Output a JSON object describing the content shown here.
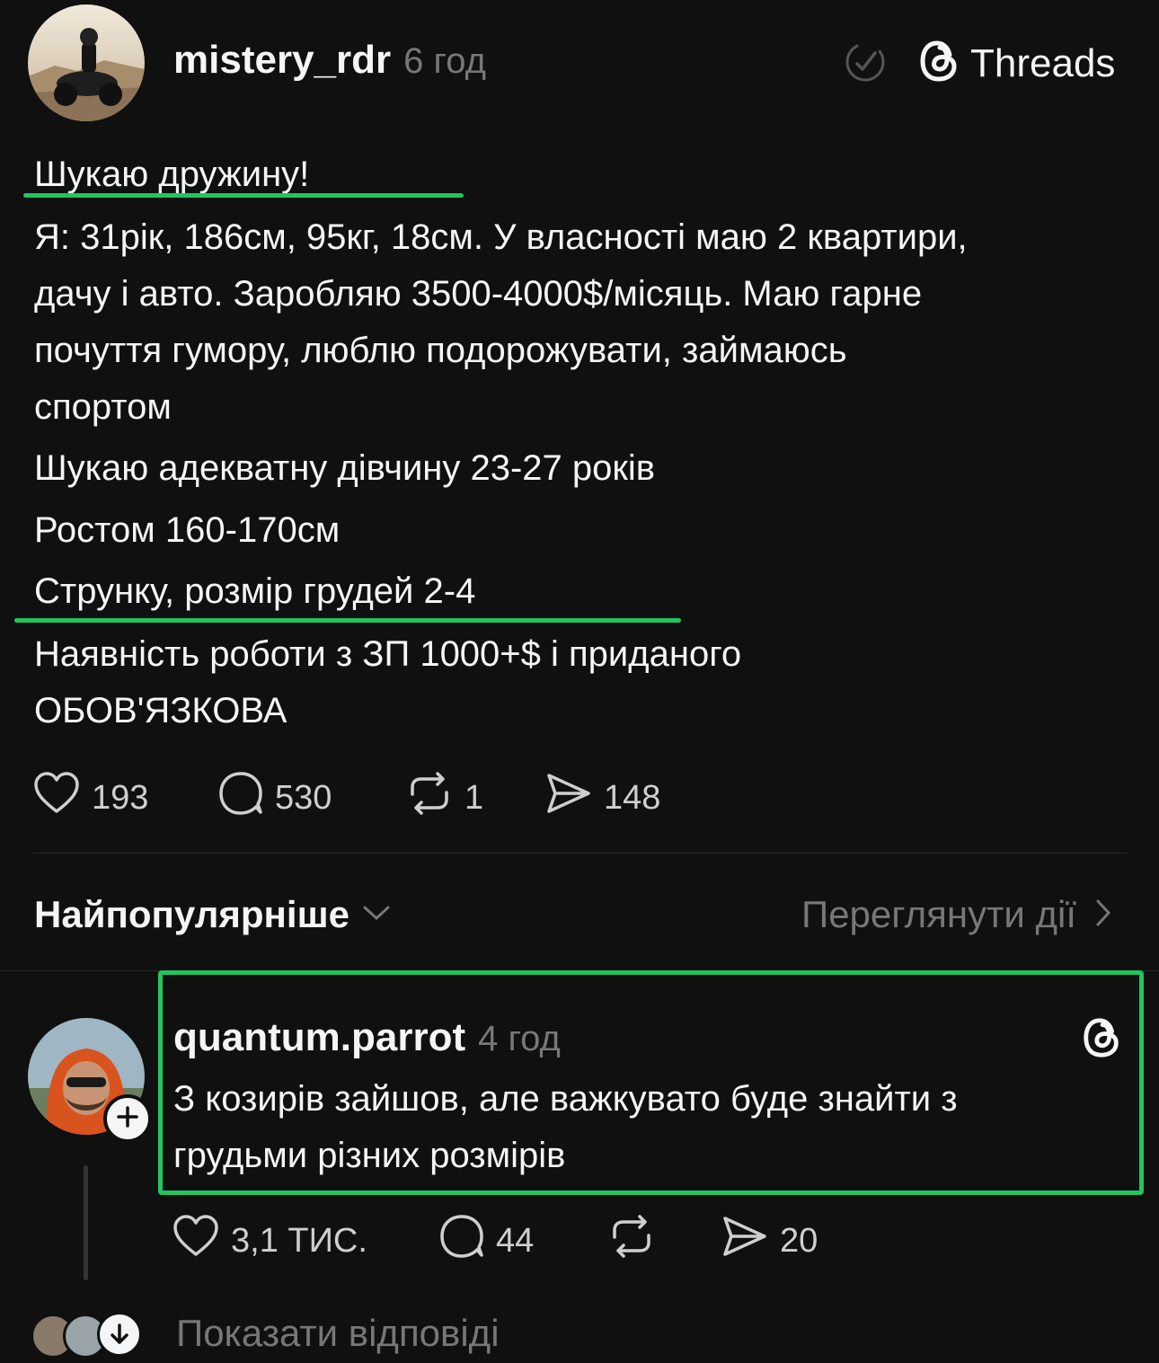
{
  "post": {
    "username": "mistery_rdr",
    "time": "6 год",
    "app_name": "Threads",
    "title": "Шукаю дружину!",
    "lines": [
      "Я: 31рік, 186см, 95кг, 18см. У власності маю 2 квартири,",
      "дачу і авто. Заробляю 3500-4000$/місяць. Маю гарне",
      "почуття гумору, люблю подорожувати, займаюсь",
      "спортом",
      "Шукаю адекватну дівчину 23-27 років",
      "Ростом 160-170см",
      "Струнку, розмір грудей 2-4",
      "Наявність роботи з ЗП 1000+$ і приданого",
      "ОБОВ'ЯЗКОВА"
    ],
    "likes": "193",
    "comments": "530",
    "reposts": "1",
    "shares": "148"
  },
  "sort": {
    "label": "Найпопулярніше",
    "view_activity": "Переглянути дії"
  },
  "reply": {
    "username": "quantum.parrot",
    "time": "4 год",
    "lines": [
      "З козирів зайшов, але важкувато буде знайти з",
      "грудьми різних розмірів"
    ],
    "likes": "3,1 ТИС.",
    "comments": "44",
    "shares": "20"
  },
  "show_replies": "Показати відповіді",
  "colors": {
    "highlight": "#22c55e",
    "background": "#101010"
  }
}
